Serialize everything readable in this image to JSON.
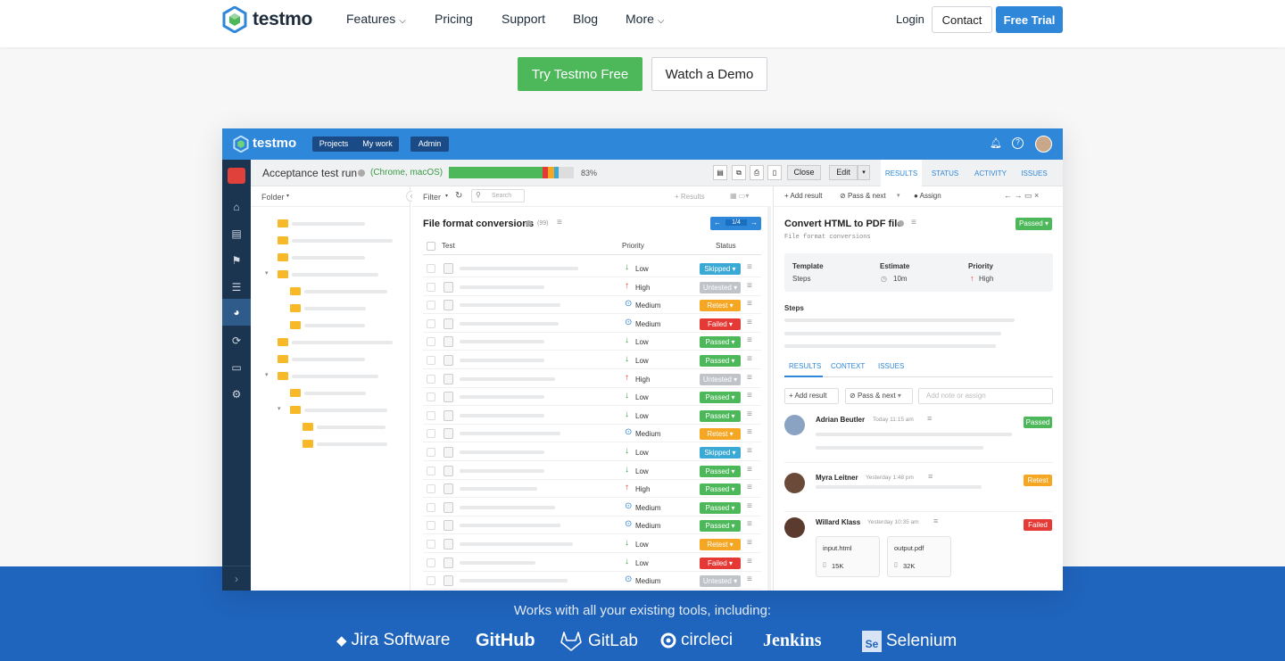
{
  "nav": {
    "brand": "testmo",
    "links": [
      {
        "label": "Features",
        "has_caret": true
      },
      {
        "label": "Pricing",
        "has_caret": false
      },
      {
        "label": "Support",
        "has_caret": false
      },
      {
        "label": "Blog",
        "has_caret": false
      },
      {
        "label": "More",
        "has_caret": true
      }
    ],
    "login": "Login",
    "contact": "Contact",
    "free_trial": "Free Trial"
  },
  "hero": {
    "try_button": "Try Testmo Free",
    "demo_button": "Watch a Demo"
  },
  "colors": {
    "primary_blue": "#2e87d8",
    "green": "#4cb85a",
    "footer_blue": "#1f64bd",
    "sidebar": "#1b3550"
  },
  "app": {
    "brand": "testmo",
    "header_tabs": [
      "Projects",
      "My work",
      "Admin"
    ],
    "run": {
      "title": "Acceptance test run",
      "config": "(Chrome, macOS)",
      "progress_percent": "83%",
      "progress_value": 0.83,
      "close_button": "Close",
      "edit_button": "Edit",
      "tabs": [
        "RESULTS",
        "STATUS",
        "ACTIVITY",
        "ISSUES"
      ]
    },
    "folder_panel": {
      "header": "Folder"
    },
    "list": {
      "filter": "Filter",
      "search_placeholder": "Search",
      "results_label": "+ Results",
      "title": "File format conversions",
      "count": "(99)",
      "pager": "1/4",
      "col_test": "Test",
      "col_priority": "Priority",
      "col_status": "Status",
      "rows": [
        {
          "priority": "Low",
          "p_icon": "arrow-down",
          "status": "Skipped",
          "color": "#3aa9d6"
        },
        {
          "priority": "High",
          "p_icon": "arrow-up",
          "status": "Untested",
          "color": "#c0c4c9"
        },
        {
          "priority": "Medium",
          "p_icon": "circle",
          "status": "Retest",
          "color": "#f5a623"
        },
        {
          "priority": "Medium",
          "p_icon": "circle",
          "status": "Failed",
          "color": "#e53935"
        },
        {
          "priority": "Low",
          "p_icon": "arrow-down",
          "status": "Passed",
          "color": "#4cb85a"
        },
        {
          "priority": "Low",
          "p_icon": "arrow-down",
          "status": "Passed",
          "color": "#4cb85a"
        },
        {
          "priority": "High",
          "p_icon": "arrow-up",
          "status": "Untested",
          "color": "#c0c4c9"
        },
        {
          "priority": "Low",
          "p_icon": "arrow-down",
          "status": "Passed",
          "color": "#4cb85a"
        },
        {
          "priority": "Low",
          "p_icon": "arrow-down",
          "status": "Passed",
          "color": "#4cb85a"
        },
        {
          "priority": "Medium",
          "p_icon": "circle",
          "status": "Retest",
          "color": "#f5a623"
        },
        {
          "priority": "Low",
          "p_icon": "arrow-down",
          "status": "Skipped",
          "color": "#3aa9d6"
        },
        {
          "priority": "Low",
          "p_icon": "arrow-down",
          "status": "Passed",
          "color": "#4cb85a"
        },
        {
          "priority": "High",
          "p_icon": "arrow-up",
          "status": "Passed",
          "color": "#4cb85a"
        },
        {
          "priority": "Medium",
          "p_icon": "circle",
          "status": "Passed",
          "color": "#4cb85a"
        },
        {
          "priority": "Medium",
          "p_icon": "circle",
          "status": "Passed",
          "color": "#4cb85a"
        },
        {
          "priority": "Low",
          "p_icon": "arrow-down",
          "status": "Retest",
          "color": "#f5a623"
        },
        {
          "priority": "Low",
          "p_icon": "arrow-down",
          "status": "Failed",
          "color": "#e53935"
        },
        {
          "priority": "Medium",
          "p_icon": "circle",
          "status": "Untested",
          "color": "#c0c4c9"
        }
      ]
    },
    "detail": {
      "add_result": "Add result",
      "pass_next": "Pass & next",
      "assign": "Assign",
      "title": "Convert HTML to PDF file",
      "subtitle": "File format conversions",
      "status": "Passed",
      "template_label": "Template",
      "template_value": "Steps",
      "estimate_label": "Estimate",
      "estimate_value": "10m",
      "priority_label": "Priority",
      "priority_value": "High",
      "steps_label": "Steps",
      "tabs": [
        "RESULTS",
        "CONTEXT",
        "ISSUES"
      ],
      "add_result_btn": "Add result",
      "pass_next_btn": "Pass & next",
      "note_placeholder": "Add note or assign",
      "results": [
        {
          "name": "Adrian Beutler",
          "time": "Today 11:15 am",
          "status": "Passed",
          "color": "#4cb85a"
        },
        {
          "name": "Myra Leitner",
          "time": "Yesterday 1:48 pm",
          "status": "Retest",
          "color": "#f5a623"
        },
        {
          "name": "Willard Klass",
          "time": "Yesterday 10:35 am",
          "status": "Failed",
          "color": "#e53935"
        }
      ],
      "attachments": [
        {
          "name": "input.html",
          "size": "15K"
        },
        {
          "name": "output.pdf",
          "size": "32K"
        }
      ]
    }
  },
  "footer": {
    "tagline": "Works with all your existing tools, including:",
    "tools": [
      "Jira Software",
      "GitHub",
      "GitLab",
      "circleci",
      "Jenkins",
      "Selenium"
    ]
  }
}
